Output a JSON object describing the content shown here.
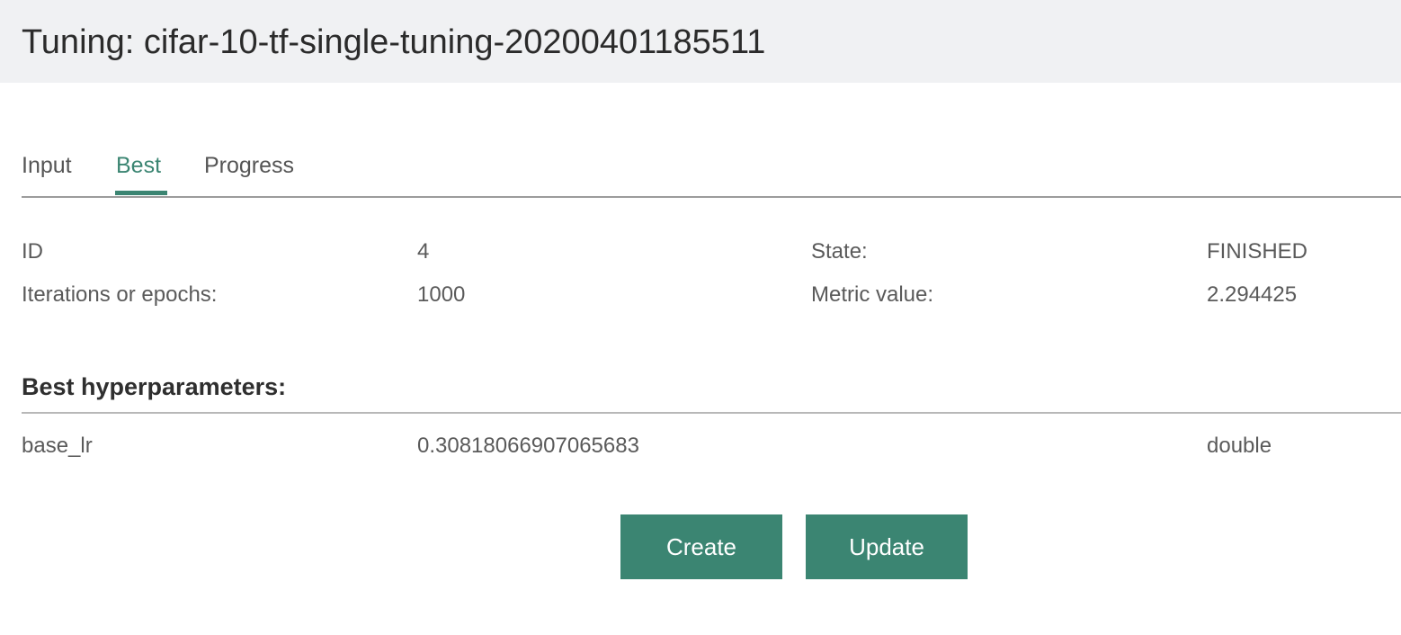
{
  "header": {
    "title": "Tuning: cifar-10-tf-single-tuning-20200401185511"
  },
  "tabs": [
    {
      "label": "Input",
      "active": false
    },
    {
      "label": "Best",
      "active": true
    },
    {
      "label": "Progress",
      "active": false
    }
  ],
  "details": {
    "id_label": "ID",
    "id_value": "4",
    "state_label": "State:",
    "state_value": "FINISHED",
    "iterations_label": "Iterations or epochs:",
    "iterations_value": "1000",
    "metric_label": "Metric value:",
    "metric_value": "2.294425"
  },
  "hyperparameters": {
    "heading": "Best hyperparameters:",
    "rows": [
      {
        "name": "base_lr",
        "value": "0.30818066907065683",
        "type": "double"
      }
    ]
  },
  "actions": {
    "create_label": "Create",
    "update_label": "Update"
  },
  "colors": {
    "accent": "#3b8572",
    "title_bar_bg": "#f0f1f3"
  }
}
